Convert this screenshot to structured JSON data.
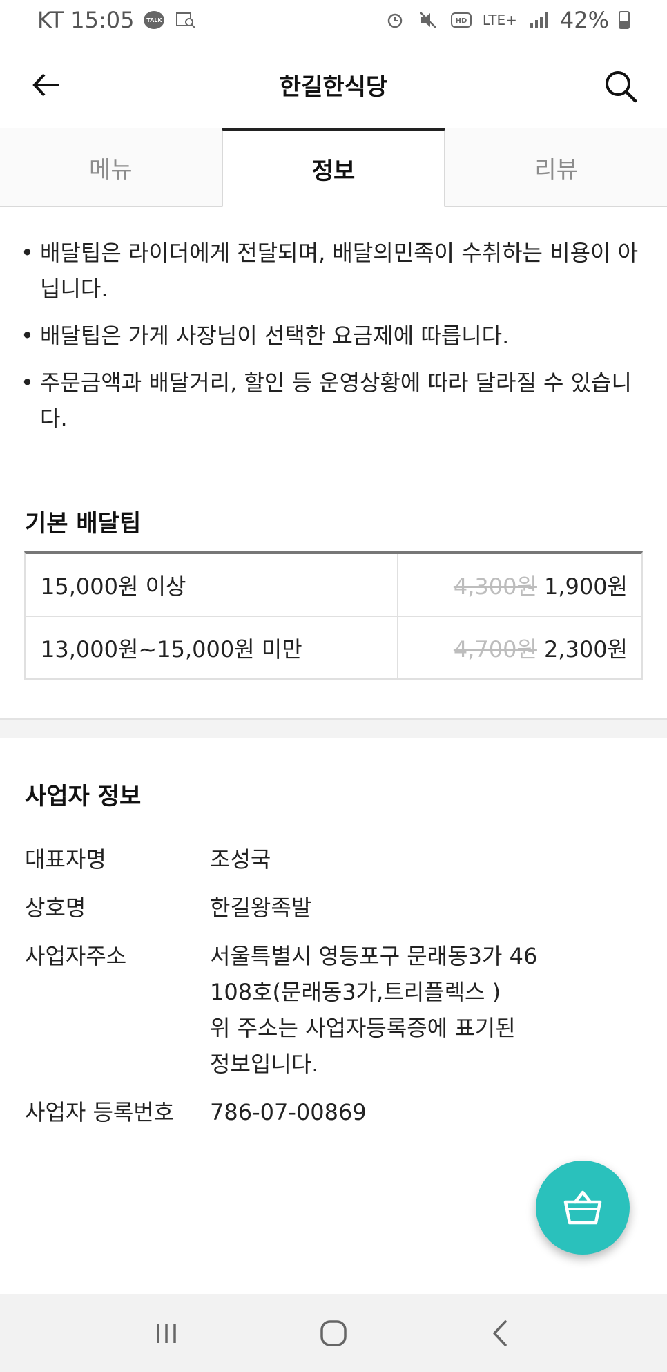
{
  "status_bar": {
    "carrier_time": "KT 15:05",
    "talk_label": "TALK",
    "network": "LTE+",
    "battery": "42%"
  },
  "header": {
    "title": "한길한식당"
  },
  "tabs": [
    {
      "label": "메뉴"
    },
    {
      "label": "정보"
    },
    {
      "label": "리뷰"
    }
  ],
  "notes": [
    "배달팁은 라이더에게 전달되며, 배달의민족이 수취하는 비용이 아닙니다.",
    "배달팁은 가게 사장님이 선택한 요금제에 따릅니다.",
    "주문금액과 배달거리, 할인 등 운영상황에 따라 달라질 수 있습니다."
  ],
  "delivery_tip": {
    "title": "기본 배달팁",
    "rows": [
      {
        "condition": "15,000원 이상",
        "original": "4,300원",
        "price": "1,900원"
      },
      {
        "condition": "13,000원~15,000원 미만",
        "original": "4,700원",
        "price": "2,300원"
      }
    ]
  },
  "business": {
    "title": "사업자 정보",
    "rows": [
      {
        "label": "대표자명",
        "value": "조성국"
      },
      {
        "label": "상호명",
        "value": "한길왕족발"
      },
      {
        "label": "사업자주소",
        "value": "서울특별시 영등포구 문래동3가 46\n108호(문래동3가,트리플렉스 )\n위 주소는 사업자등록증에 표기된\n정보입니다."
      },
      {
        "label": "사업자 등록번호",
        "value": "786-07-00869"
      }
    ]
  },
  "icons": {
    "back": "arrow-left-icon",
    "search": "search-icon",
    "cart": "basket-icon",
    "nav_recent": "recent-apps-icon",
    "nav_home": "home-icon",
    "nav_back": "back-chevron-icon"
  },
  "colors": {
    "accent": "#2ac1bc",
    "strike": "#bdbdbd"
  }
}
